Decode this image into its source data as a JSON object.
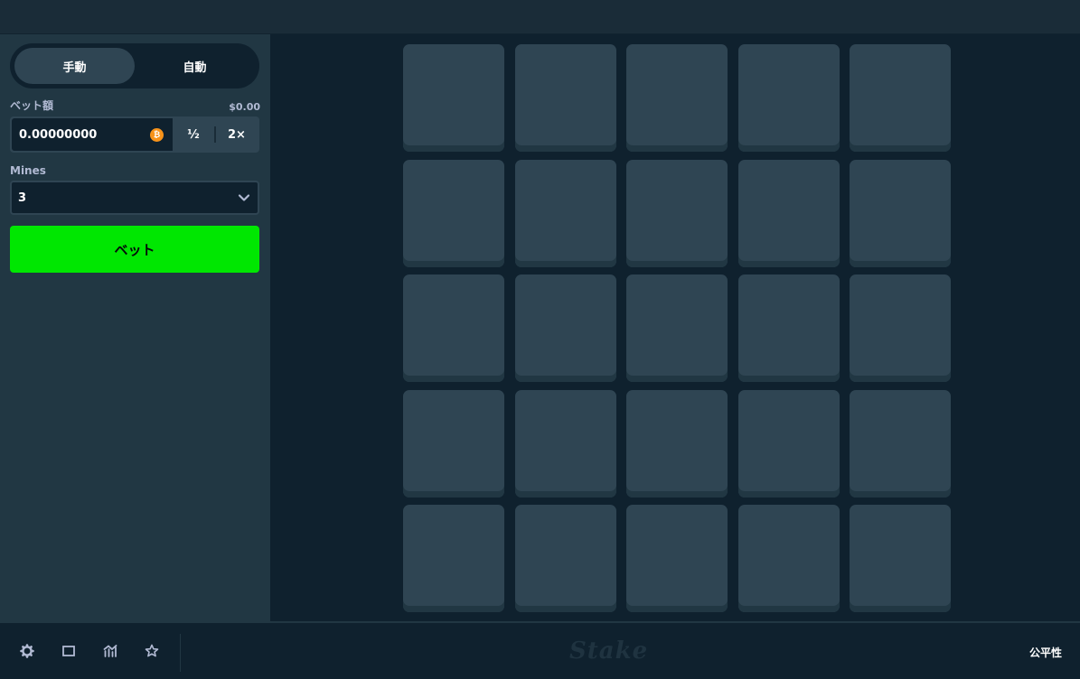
{
  "sidebar": {
    "mode_tabs": [
      {
        "label": "手動",
        "active": true
      },
      {
        "label": "自動",
        "active": false
      }
    ],
    "bet_amount": {
      "label": "ベット額",
      "usd_value": "$0.00",
      "value": "0.00000000",
      "currency_icon": "bitcoin-icon",
      "half_label": "½",
      "double_label": "2×"
    },
    "mines": {
      "label": "Mines",
      "selected": "3"
    },
    "play_button_label": "ベット"
  },
  "board": {
    "rows": 5,
    "columns": 5,
    "tile_count": 25
  },
  "footer": {
    "icons": [
      "gear-icon",
      "square-icon",
      "chart-icon",
      "star-icon"
    ],
    "logo_text": "Stake",
    "fairness_label": "公平性"
  },
  "colors": {
    "background": "#0f212e",
    "sidebar": "#213743",
    "tile": "#2f4553",
    "play_button": "#00e701"
  }
}
